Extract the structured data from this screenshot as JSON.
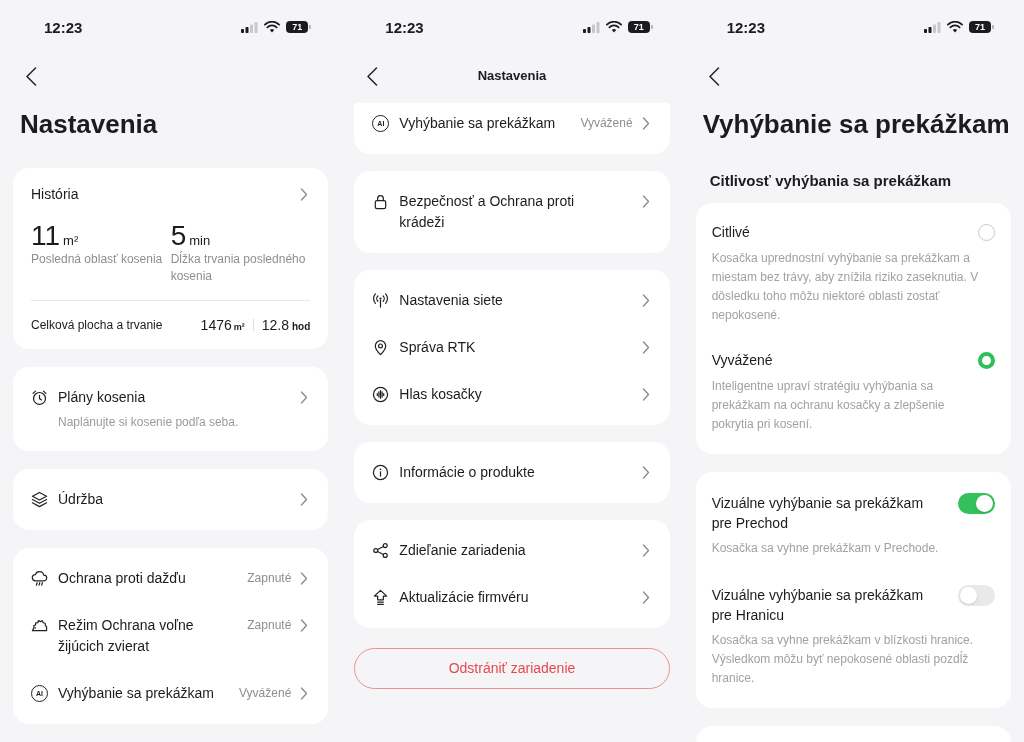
{
  "screens": [
    {
      "kind": "overview",
      "status_bar": {
        "time": "12:23",
        "battery": "71"
      },
      "title": "Nastavenia",
      "history": {
        "title": "História",
        "stats": [
          {
            "value": "11",
            "unit": "m²",
            "label": "Posledná oblasť kosenia"
          },
          {
            "value": "5",
            "unit": "min",
            "label": "Dĺžka trvania posledného kosenia"
          }
        ],
        "total": {
          "label": "Celková plocha a trvanie",
          "area": "1476",
          "area_unit": "m²",
          "duration": "12.8",
          "duration_unit": "hod"
        }
      },
      "groups": [
        {
          "items": [
            {
              "label": "Plány kosenia",
              "subtitle": "Naplánujte si kosenie podľa seba."
            }
          ]
        },
        {
          "items": [
            {
              "label": "Údržba"
            }
          ]
        },
        {
          "items": [
            {
              "label": "Ochrana proti dažďu",
              "value": "Zapnuté"
            },
            {
              "label": "Režim Ochrana voľne žijúcich zvierat",
              "value": "Zapnuté"
            },
            {
              "icon_text": "AI",
              "label": "Vyhýbanie sa prekážkam",
              "value": "Vyvážené"
            }
          ]
        }
      ]
    },
    {
      "kind": "list",
      "status_bar": {
        "time": "12:23",
        "battery": "71"
      },
      "title": "Nastavenia",
      "groups": [
        {
          "items": [
            {
              "icon_text": "AI",
              "label": "Vyhýbanie sa prekážkam",
              "value": "Vyvážené"
            }
          ]
        },
        {
          "items": [
            {
              "label": "Bezpečnosť a Ochrana proti krádeži"
            }
          ]
        },
        {
          "items": [
            {
              "label": "Nastavenia siete"
            },
            {
              "label": "Správa RTK"
            },
            {
              "label": "Hlas kosačky"
            }
          ]
        },
        {
          "items": [
            {
              "label": "Informácie o produkte"
            }
          ]
        },
        {
          "items": [
            {
              "label": "Zdieľanie zariadenia"
            },
            {
              "label": "Aktualizácie firmvéru"
            }
          ]
        }
      ],
      "remove_button": "Odstrániť zariadenie"
    },
    {
      "kind": "detail",
      "status_bar": {
        "time": "12:23",
        "battery": "71"
      },
      "title": "Vyhýbanie sa prekážkam",
      "section_title": "Citlivosť vyhýbania sa prekážkam",
      "sensitivity_options": [
        {
          "label": "Citlivé",
          "description": "Kosačka uprednostní vyhýbanie sa prekážkam a miestam bez trávy, aby znížila riziko zaseknutia. V dôsledku toho môžu niektoré oblasti zostať nepokosené.",
          "selected": false
        },
        {
          "label": "Vyvážené",
          "description": "Inteligentne upraví stratégiu vyhýbania sa prekážkam na ochranu kosačky a zlepšenie pokrytia pri kosení.",
          "selected": true
        }
      ],
      "toggles": [
        {
          "label": "Vizuálne vyhýbanie sa prekážkam pre Prechod",
          "description": "Kosačka sa vyhne prekážkam v Prechode.",
          "on": true
        },
        {
          "label": "Vizuálne vyhýbanie sa prekážkam pre Hranicu",
          "description": "Kosačka sa vyhne prekážkam v blízkosti hranice. Výsledkom môžu byť nepokosené oblasti pozdĺž hranice.",
          "on": false
        }
      ]
    }
  ]
}
